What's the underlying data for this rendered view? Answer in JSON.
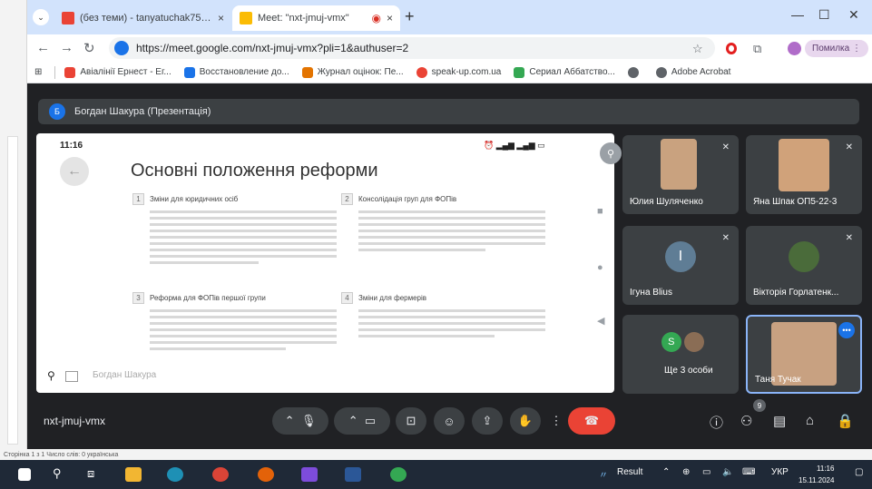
{
  "browser": {
    "tabs": [
      {
        "label": "(без теми) - tanyatuchak75@g",
        "color": "#d93025"
      },
      {
        "label": "Meet: \"nxt-jmuj-vmx\"",
        "color": "#fbbc04"
      }
    ],
    "url": "https://meet.google.com/nxt-jmuj-vmx?pli=1&authuser=2",
    "error_button": "Помилка",
    "bookmarks": [
      {
        "label": "Авіалінії Ернест - Ег...",
        "color": "#ea4335"
      },
      {
        "label": "Восстановление до...",
        "color": "#1a73e8"
      },
      {
        "label": "Журнал оцінок: Пе...",
        "color": "#e37400"
      },
      {
        "label": "speak-up.com.ua",
        "color": "#ea4335"
      },
      {
        "label": "Сериал Аббатство...",
        "color": "#34a853"
      },
      {
        "label": "",
        "color": "#5f6368"
      },
      {
        "label": "Adobe Acrobat",
        "color": "#5f6368"
      }
    ]
  },
  "meet": {
    "presenter_initial": "Б",
    "presenter": "Богдан Шакура (Презентація)",
    "slide": {
      "status_time": "11:16",
      "title": "Основні положення реформи",
      "sections": [
        {
          "num": "1",
          "title": "Зміни для юридичних осіб"
        },
        {
          "num": "2",
          "title": "Консолідація груп для ФОПів"
        },
        {
          "num": "3",
          "title": "Реформа для ФОПів першої групи"
        },
        {
          "num": "4",
          "title": "Зміни для фермерів"
        }
      ],
      "owner": "Богдан Шакура"
    },
    "participants": [
      {
        "name": "Юлия Шуляченко"
      },
      {
        "name": "Яна Шпак ОП5-22-3"
      },
      {
        "name": "Ігуна Blius",
        "initial": "І"
      },
      {
        "name": "Вікторія Горлатенк..."
      },
      {
        "name": "Ще 3 особи",
        "initial": "S"
      },
      {
        "name": "Таня Тучак"
      }
    ],
    "meeting_code": "nxt-jmuj-vmx",
    "people_badge": "9"
  },
  "word_status": "Сторінка 1 з 1    Число слів: 0    українська",
  "taskbar": {
    "app_label": "Result",
    "lang": "УКР",
    "time": "11:16",
    "date": "15.11.2024"
  }
}
